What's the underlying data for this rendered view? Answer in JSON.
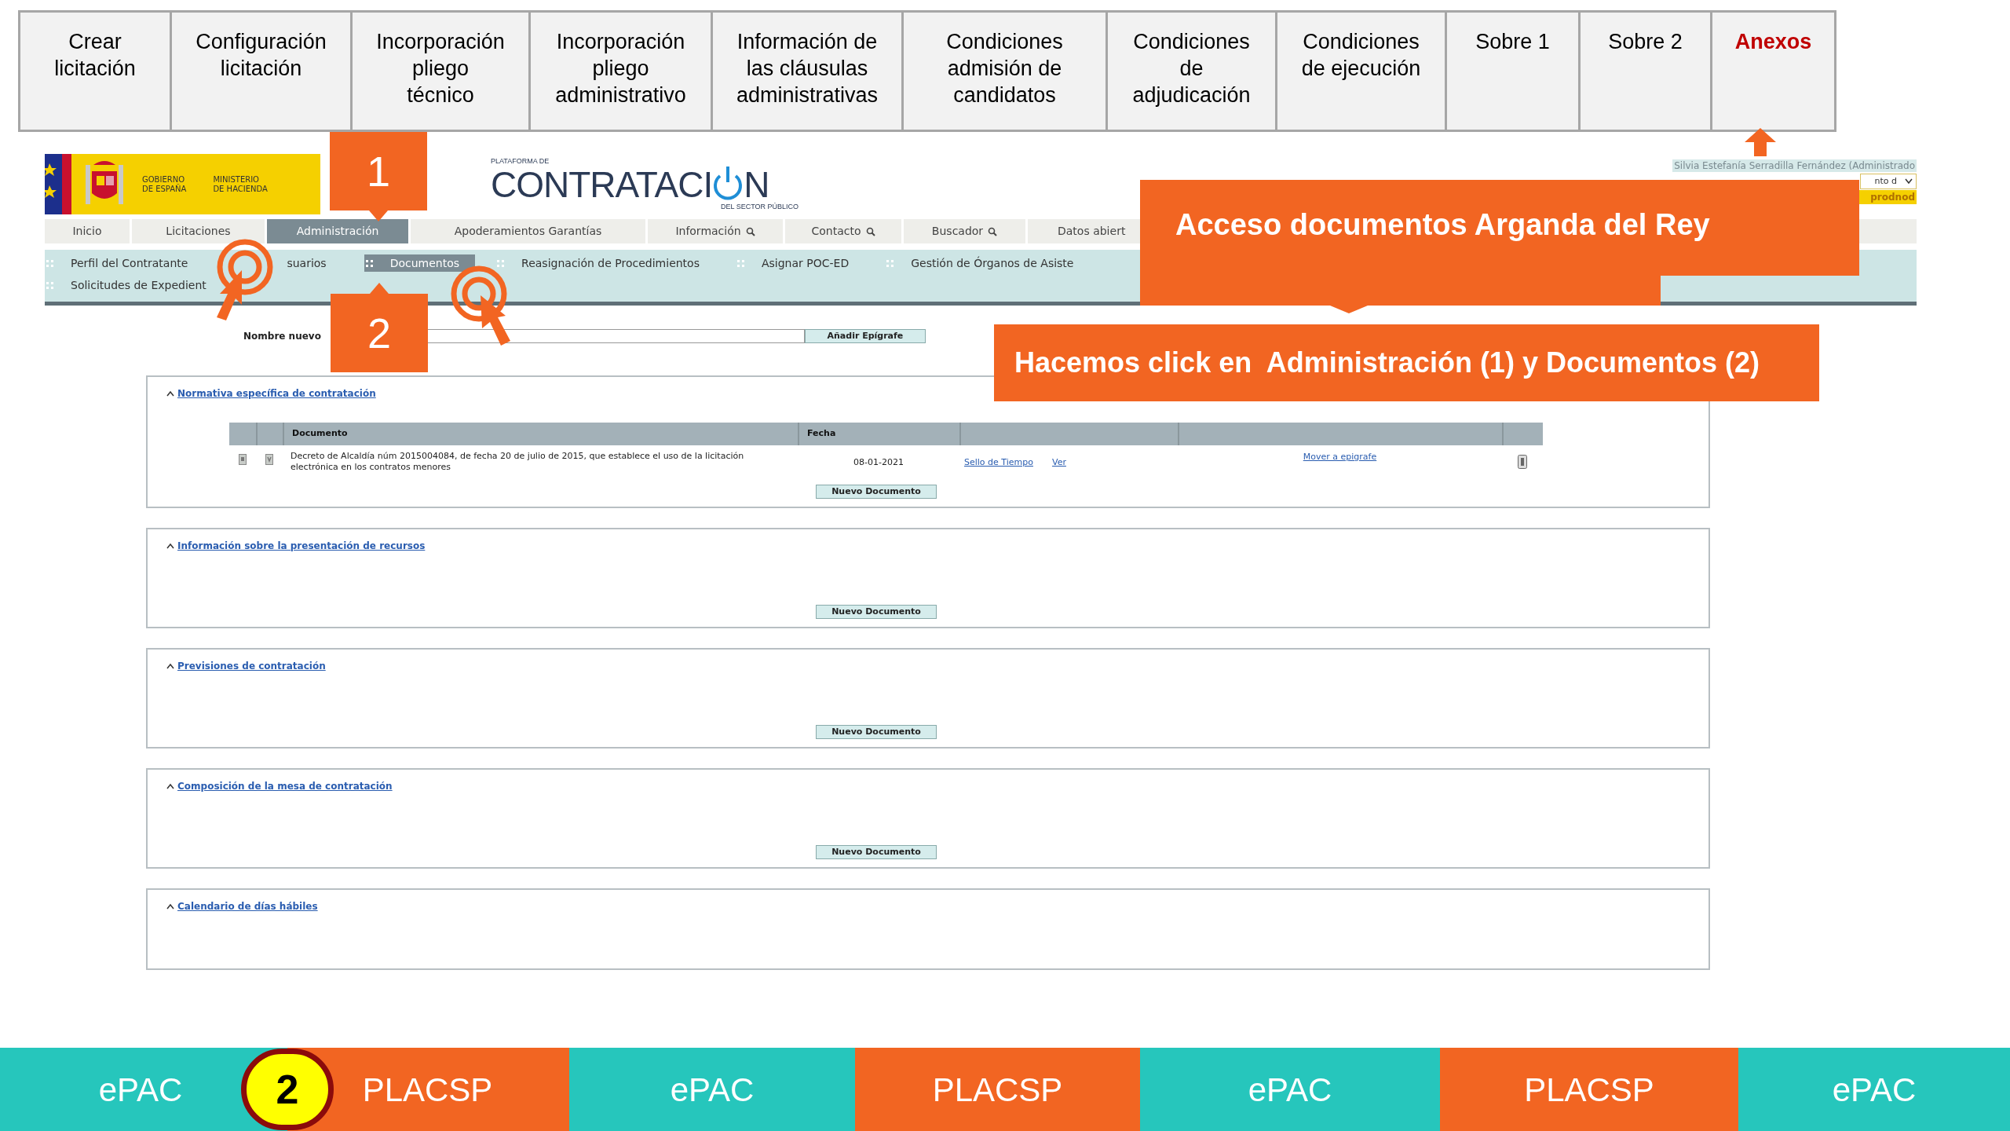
{
  "slide_tabs": [
    {
      "label": "Crear\nlicitación",
      "selected": false
    },
    {
      "label": "Configuración\nlicitación",
      "selected": false
    },
    {
      "label": "Incorporación\npliego\ntécnico",
      "selected": false
    },
    {
      "label": "Incorporación\npliego\nadministrativo",
      "selected": false
    },
    {
      "label": "Información de\nlas cláusulas\nadministrativas",
      "selected": false
    },
    {
      "label": "Condiciones\nadmisión de\ncandidatos",
      "selected": false
    },
    {
      "label": "Condiciones\nde\nadjudicación",
      "selected": false
    },
    {
      "label": "Condiciones\nde ejecución",
      "selected": false
    },
    {
      "label": "Sobre 1",
      "selected": false
    },
    {
      "label": "Sobre 2",
      "selected": false
    },
    {
      "label": "Anexos",
      "selected": true
    }
  ],
  "header": {
    "government": "GOBIERNO\nDE ESPAÑA",
    "ministry": "MINISTERIO\nDE HACIENDA",
    "platform_prefix": "PLATAFORMA DE",
    "platform_name_start": "CONTRATACI",
    "platform_name_end": "N",
    "platform_suffix": "DEL SECTOR PÚBLICO",
    "user": "Silvia Estefanía Serradilla Fernández (Administrado",
    "selector_value": "nto d",
    "profile": "prodnod"
  },
  "nav": [
    {
      "label": "Inicio",
      "selected": false,
      "search": false
    },
    {
      "label": "Licitaciones",
      "selected": false,
      "search": false
    },
    {
      "label": "Administración",
      "selected": true,
      "search": false
    },
    {
      "label": "Apoderamientos Garantías",
      "selected": false,
      "search": false
    },
    {
      "label": "Información",
      "selected": false,
      "search": true
    },
    {
      "label": "Contacto",
      "selected": false,
      "search": true
    },
    {
      "label": "Buscador",
      "selected": false,
      "search": true
    },
    {
      "label": "Datos abiert",
      "selected": false,
      "search": false
    }
  ],
  "subnav_rows": [
    [
      {
        "label": "Perfil del Contratante",
        "selected": false
      },
      {
        "label": "suarios",
        "selected": false
      },
      {
        "label": "Documentos",
        "selected": true
      },
      {
        "label": "Reasignación de Procedimientos",
        "selected": false
      },
      {
        "label": "Asignar POC-ED",
        "selected": false
      },
      {
        "label": "Gestión de Órganos de Asiste",
        "selected": false
      }
    ],
    [
      {
        "label": "Solicitudes de Expedient",
        "selected": false
      }
    ]
  ],
  "new_heading": {
    "label": "Nombre nuevo",
    "button": "Añadir Epígrafe"
  },
  "sections": [
    {
      "title": "Normativa específica de contratación",
      "expanded": true,
      "table": {
        "columns": [
          "",
          "",
          "Documento",
          "Fecha",
          "",
          "",
          ""
        ],
        "rows": [
          {
            "document": "Decreto de Alcaldía núm 2015004084, de fecha 20 de julio de 2015, que establece el uso de la licitación electrónica en los contratos menores",
            "date": "08-01-2021",
            "links": [
              "Sello de Tiempo",
              "Ver"
            ],
            "move": "Mover a epigrafe"
          }
        ]
      },
      "button": "Nuevo Documento"
    },
    {
      "title": "Información sobre la presentación de recursos",
      "expanded": true,
      "button": "Nuevo Documento"
    },
    {
      "title": "Previsiones de contratación",
      "expanded": true,
      "button": "Nuevo Documento"
    },
    {
      "title": "Composición de la mesa de contratación",
      "expanded": true,
      "button": "Nuevo Documento"
    },
    {
      "title": "Calendario de días hábiles",
      "expanded": true
    }
  ],
  "markers": [
    {
      "text": "1",
      "kind": "down"
    },
    {
      "text": "2",
      "kind": "up"
    }
  ],
  "callouts": [
    {
      "text": "Acceso documentos Arganda del Rey"
    },
    {
      "text": "Hacemos click en  Administración (1) y Documentos (2)"
    }
  ],
  "bottom_bar": [
    {
      "label": "ePAC",
      "color": "#26c6bc"
    },
    {
      "label": "PLACSP",
      "color": "#f26522"
    },
    {
      "label": "ePAC",
      "color": "#26c6bc"
    },
    {
      "label": "PLACSP",
      "color": "#f26522"
    },
    {
      "label": "ePAC",
      "color": "#26c6bc"
    },
    {
      "label": "PLACSP",
      "color": "#f26522"
    },
    {
      "label": "ePAC",
      "color": "#26c6bc"
    }
  ],
  "step_badge": {
    "text": "2"
  }
}
